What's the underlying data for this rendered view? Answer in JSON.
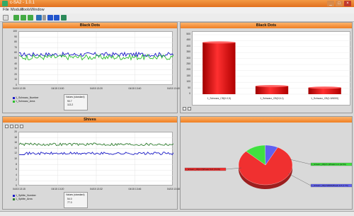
{
  "window": {
    "title": "c-SA2 - 1.0.1"
  },
  "menu": [
    "File",
    "Module",
    "Tools",
    "Window"
  ],
  "colors": {
    "accent": "#ef7e22",
    "blue": "#1a1ac8",
    "green": "#2bbf2b",
    "darkgreen": "#2e7d2e",
    "red": "#e01010"
  },
  "panels": {
    "top_left": {
      "title": "Black Dots",
      "legend": [
        {
          "name": "1_Schwarz_Number",
          "color": "#1a1ac8",
          "value": "90.7"
        },
        {
          "name": "1_Schwarz_Area",
          "color": "#2bbf2b",
          "value": "113.2"
        }
      ],
      "table_header": "Values (standard)",
      "x_ticks": [
        "04/15 12:35",
        "04/15 13:00",
        "04/15 13:20",
        "04/15 13:40",
        "04/15 13:40"
      ],
      "y_ticks": [
        "0",
        "10",
        "20",
        "30",
        "40",
        "50",
        "60",
        "70",
        "80",
        "90",
        "100"
      ]
    },
    "top_right": {
      "title": "Black Dots"
    },
    "bottom_left": {
      "title": "Shives",
      "legend": [
        {
          "name": "1_Splitte_Number",
          "color": "#1a1ac8",
          "value": "54.0"
        },
        {
          "name": "1_Splitte_Area",
          "color": "#2e7d2e",
          "value": "77.0"
        }
      ],
      "table_header": "Values (standard)",
      "x_ticks": [
        "04/15 13:15",
        "04/15 13:20",
        "04/15 13:32",
        "04/15 13:46",
        "04/15 13:48"
      ],
      "y_ticks": [
        "0",
        "2",
        "4",
        "6",
        "8",
        "10",
        "12",
        "14",
        "16",
        "18",
        "20"
      ]
    },
    "bottom_right": {
      "title": ""
    }
  },
  "chart_data": [
    {
      "type": "line",
      "title": "Black Dots",
      "ylim": [
        0,
        100
      ],
      "series": [
        {
          "name": "1_Schwarz_Number",
          "color": "#1a1ac8",
          "mean": 58,
          "noise": 4
        },
        {
          "name": "1_Schwarz_Area",
          "color": "#2bbf2b",
          "mean": 53,
          "noise": 5
        }
      ]
    },
    {
      "type": "bar",
      "title": "Black Dots",
      "categories": [
        "1_Schwarz_CB(0-0,5)",
        "1_Schwarz_CB(0,5-1)",
        "1_Schwarz_CB(1-5/6000)"
      ],
      "values": [
        435,
        68,
        55
      ],
      "ylim": [
        0,
        500
      ],
      "y_ticks": [
        "0",
        "50",
        "100",
        "150",
        "200",
        "250",
        "300",
        "350",
        "400",
        "450",
        "500"
      ]
    },
    {
      "type": "line",
      "title": "Shives",
      "ylim": [
        0,
        20
      ],
      "series": [
        {
          "name": "1_Splitte_Number",
          "color": "#1a1ac8",
          "mean": 12.2,
          "noise": 0.5
        },
        {
          "name": "1_Splitte_Area",
          "color": "#2e7d2e",
          "mean": 15.6,
          "noise": 0.5
        }
      ]
    },
    {
      "type": "pie",
      "slices": [
        {
          "label": "1_Schwarz_CB(0-0,5)Pbeals 52.8 (79.6%)",
          "value": 79.6,
          "color": "#f03030"
        },
        {
          "label": "1_Schwarz_CB(0,5-1)Pbeals 11.4 (12.6%)",
          "value": 12.6,
          "color": "#40e040"
        },
        {
          "label": "1_Schwarz_CB(1-5/6000)Pbeals 11.5 (7.7%)",
          "value": 7.7,
          "color": "#6060f0"
        }
      ]
    }
  ]
}
